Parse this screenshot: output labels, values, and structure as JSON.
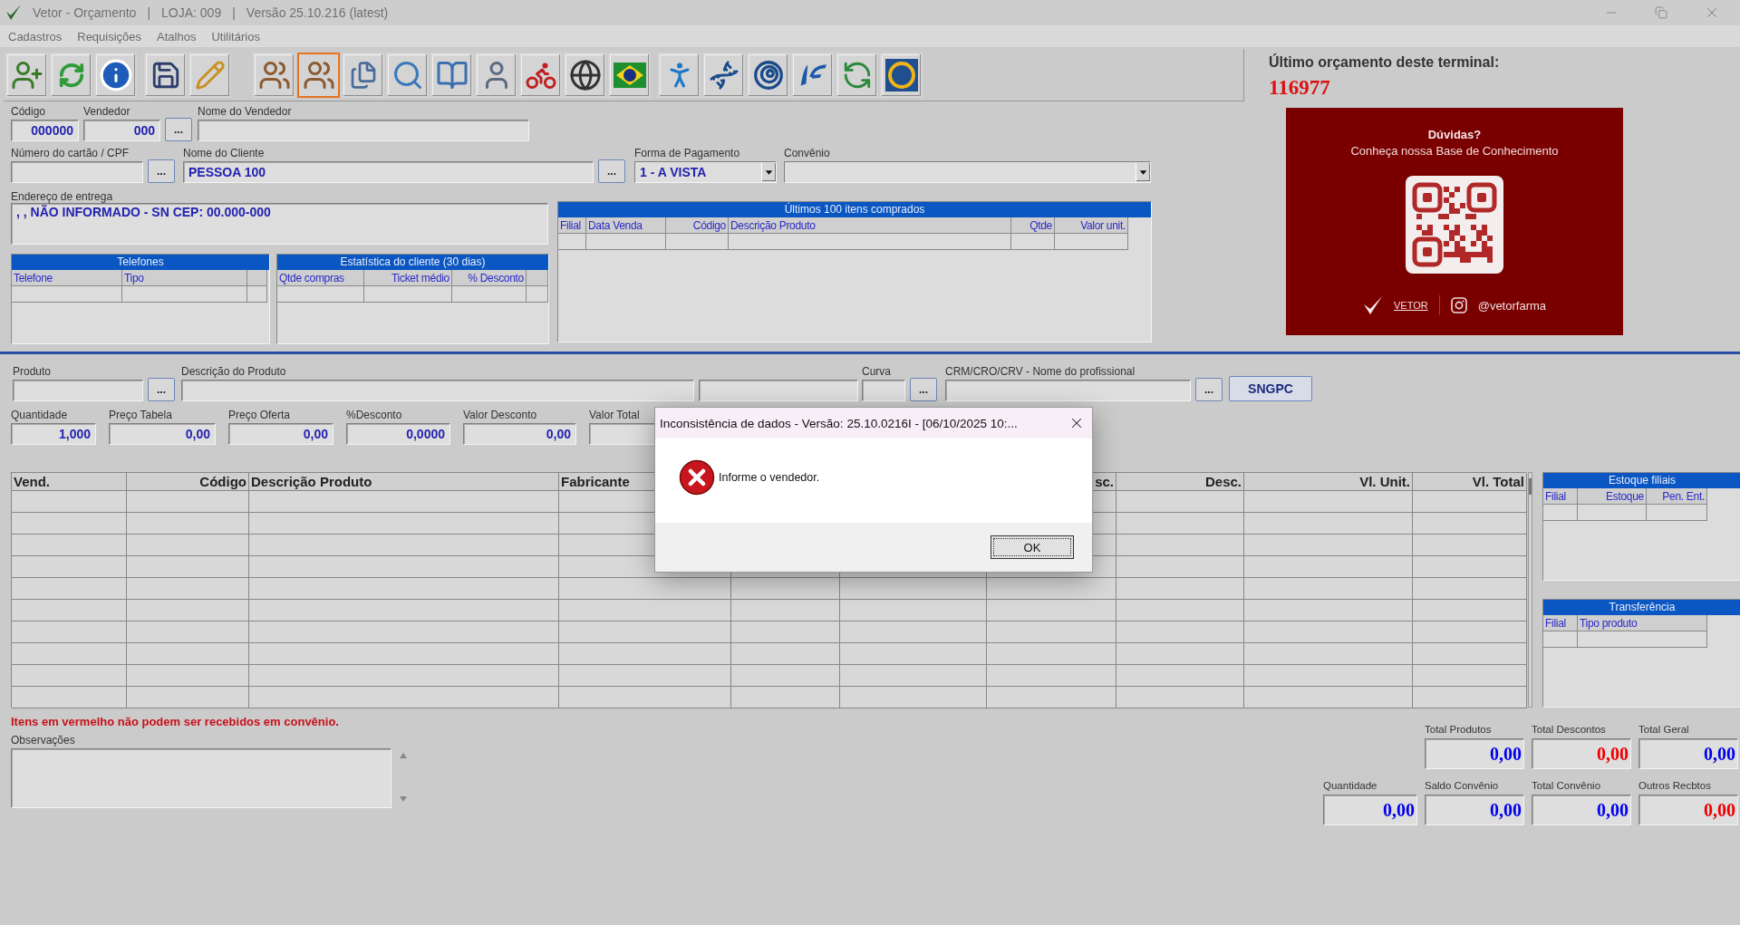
{
  "window": {
    "title": "Vetor - Orçamento",
    "store": "LOJA: 009",
    "version": "Versão 25.10.216 (latest)",
    "separators": [
      "|",
      "|"
    ]
  },
  "menu": [
    "Cadastros",
    "Requisições",
    "Atalhos",
    "Utilitários"
  ],
  "toolbar": [
    {
      "selected": false
    },
    {
      "selected": false
    },
    {
      "selected": false
    },
    {
      "selected": false
    },
    {
      "selected": false
    },
    {
      "selected": false
    },
    {
      "selected": true
    },
    {
      "selected": false
    },
    {
      "selected": false
    },
    {
      "selected": false
    },
    {
      "selected": false
    },
    {
      "selected": false
    },
    {
      "selected": false
    },
    {
      "selected": false
    },
    {
      "selected": false
    },
    {
      "selected": false
    },
    {
      "selected": false
    },
    {
      "selected": false
    },
    {
      "selected": false
    },
    {
      "selected": false
    }
  ],
  "last_budget": {
    "label": "Último orçamento deste terminal:",
    "number": "116977"
  },
  "banner": {
    "title": "Dúvidas?",
    "subtitle": "Conheça nossa Base de Conhecimento",
    "brand": "VETOR",
    "handle": "@vetorfarma"
  },
  "header_form": {
    "codigo": {
      "label": "Código",
      "value": "000000"
    },
    "vendedor": {
      "label": "Vendedor",
      "value": "000",
      "button": "..."
    },
    "nome_vendedor": {
      "label": "Nome do Vendedor"
    },
    "cartao": {
      "label": "Número do cartão / CPF",
      "button": "..."
    },
    "cliente": {
      "label": "Nome do Cliente",
      "value": "PESSOA 100",
      "button": "..."
    },
    "pagamento": {
      "label": "Forma de Pagamento",
      "value": "1 - A VISTA"
    },
    "convenio": {
      "label": "Convênio"
    },
    "endereco": {
      "label": "Endereço de entrega",
      "value": ", , NÃO INFORMADO - SN CEP: 00.000-000"
    }
  },
  "grids": {
    "telefones": {
      "title": "Telefones",
      "columns": [
        "Telefone",
        "Tipo"
      ]
    },
    "estatistica": {
      "title": "Estatística do cliente (30 dias)",
      "columns": [
        "Qtde compras",
        "Ticket médio",
        "% Desconto"
      ]
    },
    "ultimos": {
      "title": "Últimos 100 itens comprados",
      "columns": [
        "Filial",
        "Data Venda",
        "Código",
        "Descrição Produto",
        "Qtde",
        "Valor unit."
      ]
    },
    "estoque": {
      "title": "Estoque filiais",
      "columns": [
        "Filial",
        "Estoque",
        "Pen. Ent."
      ]
    },
    "transferencia": {
      "title": "Transferência",
      "columns": [
        "Filial",
        "Tipo produto"
      ]
    }
  },
  "product_form": {
    "produto": {
      "label": "Produto",
      "button": "..."
    },
    "descricao": {
      "label": "Descrição do Produto"
    },
    "curva": {
      "label": "Curva",
      "button": "..."
    },
    "crm": {
      "label": "CRM/CRO/CRV - Nome do profissional",
      "button": "..."
    },
    "sngpc": "SNGPC"
  },
  "quantities": [
    {
      "label": "Quantidade",
      "value": "1,000"
    },
    {
      "label": "Preço Tabela",
      "value": "0,00"
    },
    {
      "label": "Preço Oferta",
      "value": "0,00"
    },
    {
      "label": "%Desconto",
      "value": "0,0000"
    },
    {
      "label": "Valor Desconto",
      "value": "0,00"
    },
    {
      "label": "Valor Total"
    }
  ],
  "items_table": {
    "columns": [
      "Vend.",
      "Código",
      "Descrição Produto",
      "Fabricante",
      "sc.",
      "Desc.",
      "Vl. Unit.",
      "Vl. Total"
    ]
  },
  "note": "Itens em vermelho não podem ser recebidos em convênio.",
  "observacoes": {
    "label": "Observações"
  },
  "totals_top": [
    {
      "label": "Total Produtos",
      "value": "0,00",
      "color": "#0000ee"
    },
    {
      "label": "Total Descontos",
      "value": "0,00",
      "color": "#ee0000"
    },
    {
      "label": "Total Geral",
      "value": "0,00",
      "color": "#0000ee"
    }
  ],
  "totals_bottom": [
    {
      "label": "Quantidade",
      "value": "0,00",
      "color": "#0000ee"
    },
    {
      "label": "Saldo Convênio",
      "value": "0,00",
      "color": "#0000ee"
    },
    {
      "label": "Total Convênio",
      "value": "0,00",
      "color": "#0000ee"
    },
    {
      "label": "Outros Recbtos",
      "value": "0,00",
      "color": "#ee0000"
    }
  ],
  "dialog": {
    "title": "Inconsistência de dados - Versão: 25.10.0216I - [06/10/2025 10:...",
    "message": "Informe o vendedor.",
    "button": "OK"
  }
}
